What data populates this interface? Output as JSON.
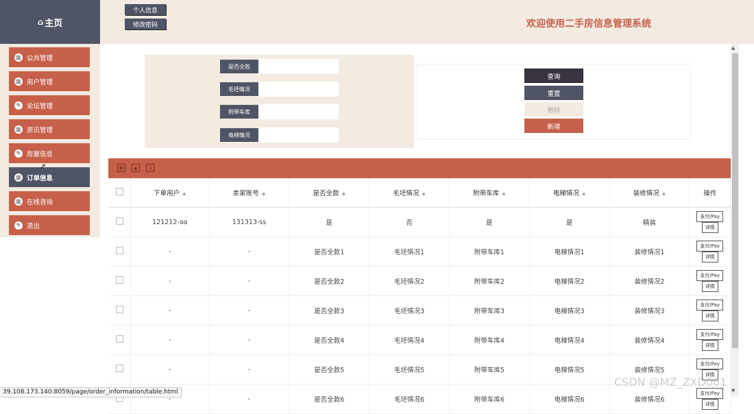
{
  "header": {
    "home_label": "主页",
    "profile_btn": "个人信息",
    "password_btn": "修改密码",
    "site_title": "欢迎使用二手房信息管理系统"
  },
  "sidebar": {
    "items": [
      {
        "label": "公共管理",
        "icon": "chart-icon"
      },
      {
        "label": "用户管理",
        "icon": "chart-icon"
      },
      {
        "label": "论坛管理",
        "icon": "edit-icon"
      },
      {
        "label": "资讯管理",
        "icon": "chart-icon"
      },
      {
        "label": "房屋信息",
        "icon": "edit-icon"
      },
      {
        "label": "订单信息",
        "icon": "chart-icon",
        "active": true
      },
      {
        "label": "在线咨询",
        "icon": "chart-icon"
      },
      {
        "label": "退出",
        "icon": "edit-icon"
      }
    ]
  },
  "search": {
    "fields": [
      {
        "label": "是否全款",
        "value": ""
      },
      {
        "label": "毛坯情况",
        "value": ""
      },
      {
        "label": "附带车库",
        "value": ""
      },
      {
        "label": "电梯情况",
        "value": ""
      }
    ]
  },
  "actions": {
    "query": "查询",
    "reset": "重置",
    "delete": "删除",
    "add": "新增"
  },
  "table": {
    "columns": [
      "下单用户",
      "卖家账号",
      "是否全款",
      "毛坯情况",
      "附带车库",
      "电梯情况",
      "装修情况"
    ],
    "ops_header": "操作",
    "pay_label": "支付/Pay",
    "detail_label": "详情",
    "rows": [
      [
        "121212-aa",
        "131313-ss",
        "是",
        "否",
        "是",
        "是",
        "精装"
      ],
      [
        "-",
        "-",
        "是否全款1",
        "毛坯情况1",
        "附带车库1",
        "电梯情况1",
        "装修情况1"
      ],
      [
        "-",
        "-",
        "是否全款2",
        "毛坯情况2",
        "附带车库2",
        "电梯情况2",
        "装修情况2"
      ],
      [
        "-",
        "-",
        "是否全款3",
        "毛坯情况3",
        "附带车库3",
        "电梯情况3",
        "装修情况3"
      ],
      [
        "-",
        "-",
        "是否全款4",
        "毛坯情况4",
        "附带车库4",
        "电梯情况4",
        "装修情况4"
      ],
      [
        "-",
        "-",
        "是否全款5",
        "毛坯情况5",
        "附带车库5",
        "电梯情况5",
        "装修情况5"
      ],
      [
        "-",
        "-",
        "是否全款6",
        "毛坯情况6",
        "附带车库6",
        "电梯情况6",
        "装修情况6"
      ]
    ]
  },
  "status_url": "39.108.173.140:8059/page/order_information/table.html",
  "watermark": "CSDN @MZ_ZXD001",
  "colors": {
    "accent": "#c7604a",
    "dark": "#4f5566",
    "panel": "#f3ebe1"
  }
}
